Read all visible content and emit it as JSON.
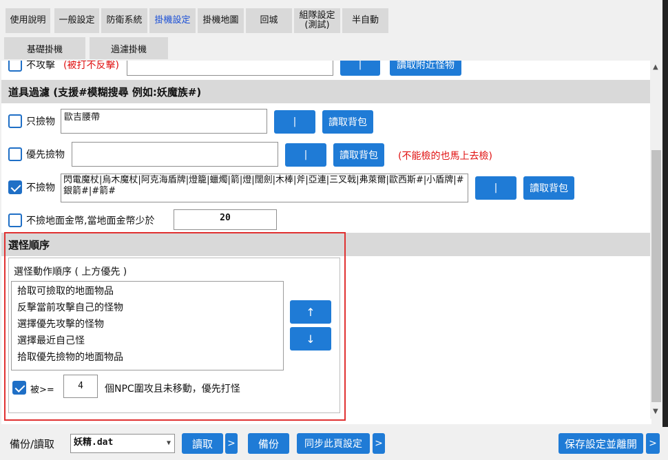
{
  "tabs": [
    "使用說明",
    "一般設定",
    "防衛系統",
    "掛機設定",
    "掛機地圖",
    "回城",
    "組隊設定\n(測試)",
    "半自動"
  ],
  "active_tab": "掛機設定",
  "subtabs": [
    "基礎掛機",
    "過濾掛機"
  ],
  "top_row": {
    "checkbox_label": "不攻擊",
    "note": "(被打不反擊)",
    "pipe_button": "|",
    "read_button": "讀取附近怪物"
  },
  "item_filter": {
    "title": "道具過濾 (支援#模糊搜尋 例如:妖魔族#)",
    "only_pick": {
      "label": "只撿物",
      "value": "歐吉腰帶",
      "checked": false,
      "pipe": "|",
      "read": "讀取背包"
    },
    "priority_pick": {
      "label": "優先撿物",
      "value": "",
      "checked": false,
      "pipe": "|",
      "read": "讀取背包",
      "note": "(不能檢的也馬上去檢)"
    },
    "no_pick": {
      "label": "不撿物",
      "value": "閃電魔杖|烏木魔杖|阿克海盾牌|燈籠|蠟燭|箭|燈|闊劍|木棒|斧|亞連|三叉戟|弗萊爾|歐西斯#|小盾牌|#銀箭#|#箭#",
      "checked": true,
      "pipe": "|",
      "read": "讀取背包"
    },
    "no_coin": {
      "label": "不撿地面金幣,當地面金幣少於",
      "value": "20",
      "checked": false
    }
  },
  "monster_order": {
    "title": "選怪順序",
    "group_label": "選怪動作順序 ( 上方優先 )",
    "list": [
      "拾取可撿取的地面物品",
      "反擊當前攻擊自己的怪物",
      "選擇優先攻擊的怪物",
      "選擇最近自己怪",
      "拾取優先撿物的地面物品"
    ],
    "up_button": "↑",
    "down_button": "↓",
    "npc": {
      "checked": true,
      "prefix": "被>=",
      "value": "4",
      "suffix": "個NPC圍攻且未移動，優先打怪"
    }
  },
  "bottom": {
    "backup_label": "備份/讀取",
    "file_value": "妖精.dat",
    "read_button": "讀取",
    "more1": ">",
    "backup_button": "備份",
    "sync_button": "同步此頁設定",
    "more2": ">",
    "save_button": "保存設定並離開",
    "more3": ">"
  },
  "colors": {
    "accent_blue": "#1f7bd6",
    "highlight_red": "#e03030",
    "active_tab_text": "#1a4fd6"
  }
}
